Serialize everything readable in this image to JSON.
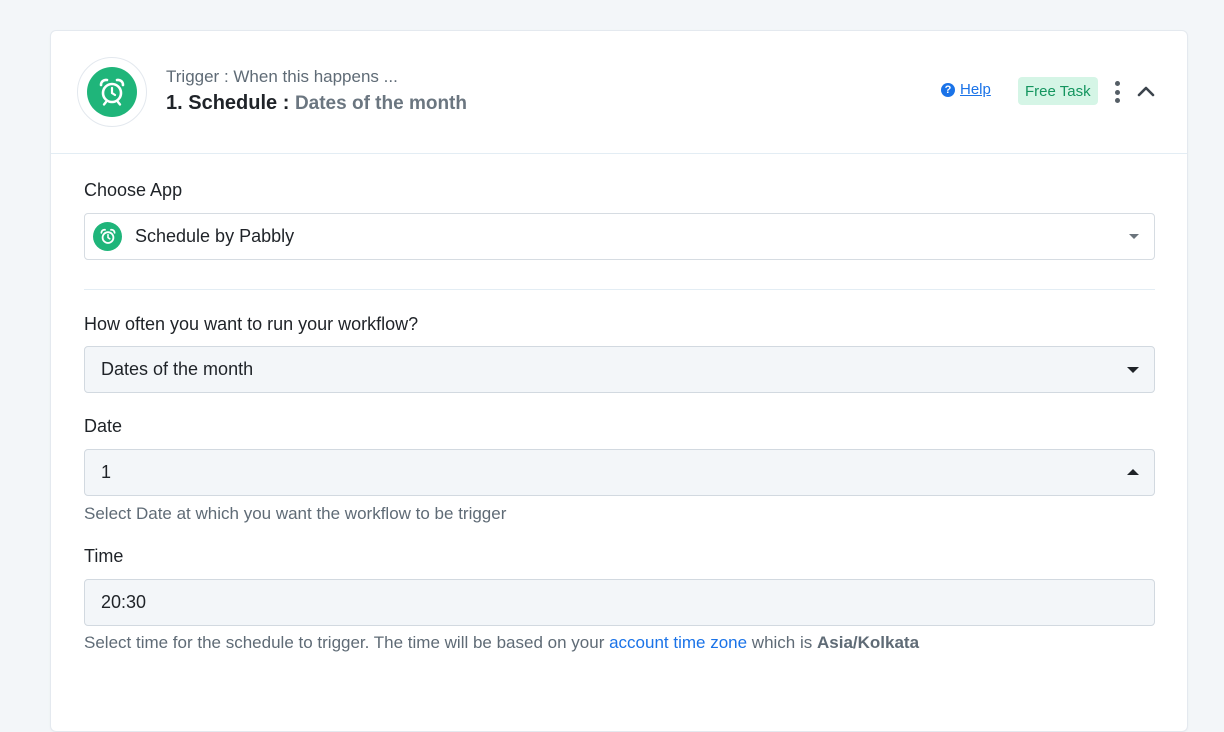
{
  "header": {
    "subtitle": "Trigger : When this happens ...",
    "title_prefix": "1. Schedule :",
    "title_event": "Dates of the month",
    "help_label": "Help",
    "badge_label": "Free Task"
  },
  "choose_app": {
    "label": "Choose App",
    "selected": "Schedule by Pabbly"
  },
  "frequency": {
    "label": "How often you want to run your workflow?",
    "value": "Dates of the month"
  },
  "date": {
    "label": "Date",
    "value": "1",
    "hint": "Select Date at which you want the workflow to be trigger"
  },
  "time": {
    "label": "Time",
    "value": "20:30",
    "hint_prefix": "Select time for the schedule to trigger. The time will be based on your",
    "hint_link": "account time zone",
    "hint_middle": "which is",
    "hint_zone": "Asia/Kolkata"
  },
  "colors": {
    "brand_green": "#1fb57a",
    "link_blue": "#1a73e8",
    "badge_bg": "#d5f5e6",
    "badge_text": "#14955f"
  }
}
